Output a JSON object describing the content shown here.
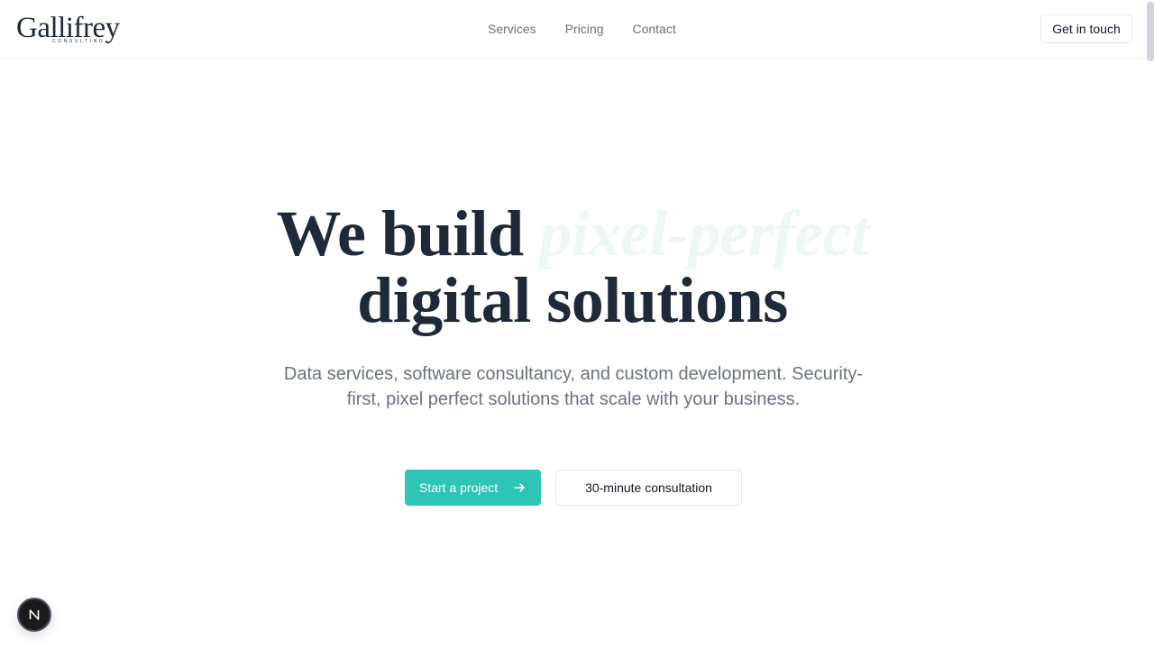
{
  "brand": {
    "name": "Gallifrey",
    "tagline": "CONSULTING"
  },
  "nav": {
    "items": [
      {
        "label": "Services"
      },
      {
        "label": "Pricing"
      },
      {
        "label": "Contact"
      }
    ],
    "cta_label": "Get in touch"
  },
  "hero": {
    "headline_start": "We build",
    "headline_accent": "pixel-perfect",
    "headline_end": "digital solutions",
    "subtitle": "Data services, software consultancy, and custom development. Security-first, pixel perfect solutions that scale with your business.",
    "primary_cta": "Start a project",
    "primary_cta_icon": "arrow-right-icon",
    "secondary_cta": "30-minute consultation"
  },
  "devtools": {
    "icon": "next-logo-icon",
    "letter": "N"
  },
  "colors": {
    "accent": "#2ec4b6",
    "heading": "#1e2a3a",
    "muted_text": "#6b7280",
    "accent_faded": "#edf8f5"
  }
}
